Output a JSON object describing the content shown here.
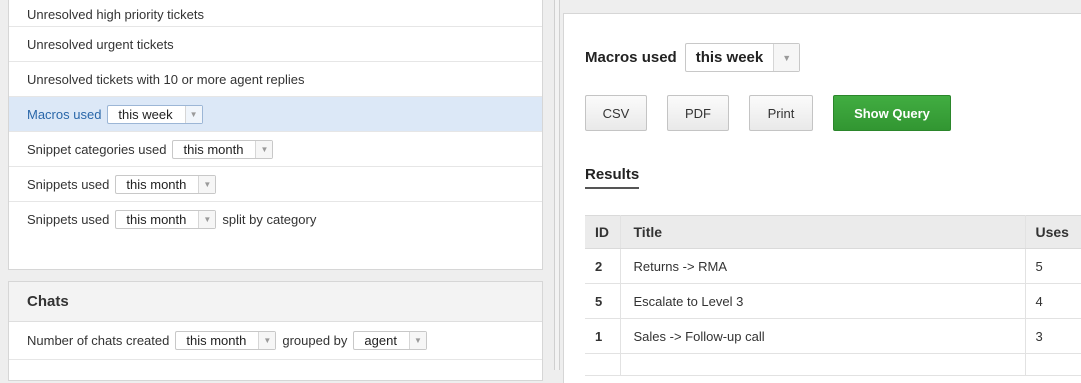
{
  "left": {
    "reports": [
      {
        "label": "Unresolved high priority tickets"
      },
      {
        "label": "Unresolved urgent tickets"
      },
      {
        "label": "Unresolved tickets with 10 or more agent replies"
      },
      {
        "label": "Macros used",
        "select": "this week",
        "active": true
      },
      {
        "label": "Snippet categories used",
        "select": "this month"
      },
      {
        "label": "Snippets used",
        "select": "this month"
      },
      {
        "label": "Snippets used",
        "select": "this month",
        "suffix": "split by category"
      }
    ],
    "chats": {
      "title": "Chats",
      "item": {
        "label": "Number of chats created",
        "select1": "this month",
        "mid": "grouped by",
        "select2": "agent"
      }
    }
  },
  "right": {
    "title": "Macros used",
    "period": "this week",
    "buttons": {
      "csv": "CSV",
      "pdf": "PDF",
      "print": "Print",
      "query": "Show Query"
    },
    "results_heading": "Results",
    "table": {
      "headers": [
        "ID",
        "Title",
        "Uses"
      ],
      "rows": [
        {
          "id": "2",
          "title": "Returns -> RMA",
          "uses": "5"
        },
        {
          "id": "5",
          "title": "Escalate to Level 3",
          "uses": "4"
        },
        {
          "id": "1",
          "title": "Sales -> Follow-up call",
          "uses": "3"
        }
      ]
    }
  },
  "colors": {
    "active_bg": "#dce8f7",
    "active_text": "#2a67a9",
    "query_button": "#3aa33a"
  },
  "icons": {
    "dropdown": "chevron-down-icon"
  }
}
